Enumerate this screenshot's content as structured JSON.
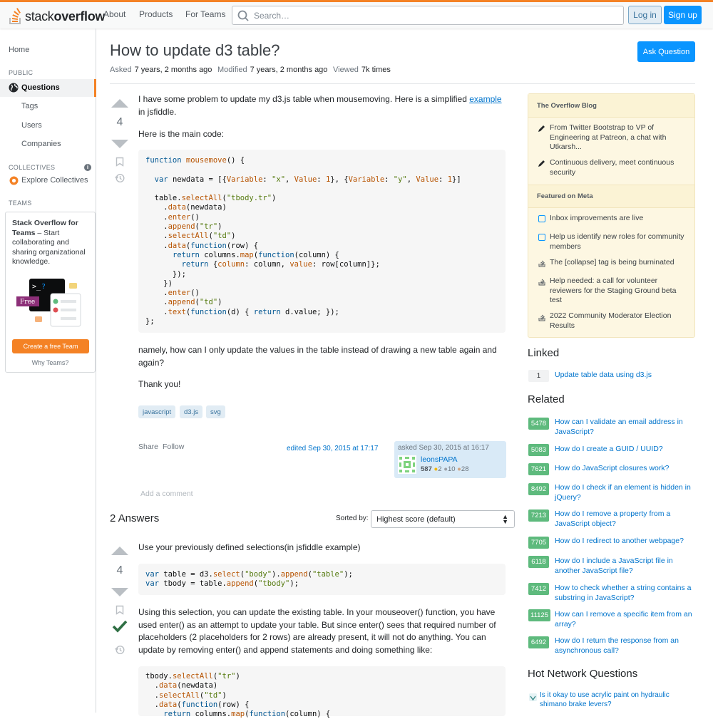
{
  "header": {
    "logo_light": "stack",
    "logo_bold": "overflow",
    "nav": [
      "About",
      "Products",
      "For Teams"
    ],
    "search_placeholder": "Search…",
    "login": "Log in",
    "signup": "Sign up"
  },
  "sidebar": {
    "home": "Home",
    "public_label": "PUBLIC",
    "questions": "Questions",
    "tags": "Tags",
    "users": "Users",
    "companies": "Companies",
    "collectives_label": "COLLECTIVES",
    "explore_collectives": "Explore Collectives",
    "teams_label": "TEAMS",
    "teams_promo_bold": "Stack Overflow for Teams",
    "teams_promo_text": " – Start collaborating and sharing organizational knowledge.",
    "free_badge": "Free",
    "create_team": "Create a free Team",
    "why_teams": "Why Teams?"
  },
  "question": {
    "title": "How to update d3 table?",
    "ask_button": "Ask Question",
    "asked_label": "Asked",
    "asked_value": "7 years, 2 months ago",
    "modified_label": "Modified",
    "modified_value": "7 years, 2 months ago",
    "viewed_label": "Viewed",
    "viewed_value": "7k times",
    "votes": "4",
    "intro_1": "I have some problem to update my d3.js table when mousemoving. Here is a simplified ",
    "intro_link": "example",
    "intro_2": " in jsfiddle.",
    "main_code_label": "Here is the main code:",
    "outro": "namely, how can I only update the values in the table instead of drawing a new table again and again?",
    "thanks": "Thank you!",
    "tags": [
      "javascript",
      "d3.js",
      "svg"
    ],
    "share": "Share",
    "follow": "Follow",
    "edited": "edited Sep 30, 2015 at 17:17",
    "asked_card": "asked Sep 30, 2015 at 16:17",
    "owner_name": "leonsPAPA",
    "owner_rep": "587",
    "owner_gold": "2",
    "owner_silver": "10",
    "owner_bronze": "28",
    "add_comment": "Add a comment"
  },
  "answers": {
    "heading": "2 Answers",
    "sorted_by": "Sorted by:",
    "sort_value": "Highest score (default)",
    "first": {
      "votes": "4",
      "intro": "Use your previously defined selections(in jsfiddle example)",
      "body": "Using this selection, you can update the existing table. In your mouseover() function, you have used enter() as an attempt to update your table. But since enter() sees that required number of placeholders (2 placeholders for 2 rows) are already present, it will not do anything. You can update by removing enter() and append statements and doing something like:"
    }
  },
  "blog": {
    "heading1": "The Overflow Blog",
    "items1": [
      "From Twitter Bootstrap to VP of Engineering at Patreon, a chat with Utkarsh...",
      "Continuous delivery, meet continuous security"
    ],
    "heading2": "Featured on Meta",
    "items2": [
      "Inbox improvements are live",
      "Help us identify new roles for community members",
      "The [collapse] tag is being burninated",
      "Help needed: a call for volunteer reviewers for the Staging Ground beta test",
      "2022 Community Moderator Election Results"
    ]
  },
  "linked": {
    "heading": "Linked",
    "items": [
      {
        "score": "1",
        "title": "Update table data using d3.js"
      }
    ]
  },
  "related": {
    "heading": "Related",
    "items": [
      {
        "score": "5478",
        "title": "How can I validate an email address in JavaScript?"
      },
      {
        "score": "5083",
        "title": "How do I create a GUID / UUID?"
      },
      {
        "score": "7621",
        "title": "How do JavaScript closures work?"
      },
      {
        "score": "8492",
        "title": "How do I check if an element is hidden in jQuery?"
      },
      {
        "score": "7213",
        "title": "How do I remove a property from a JavaScript object?"
      },
      {
        "score": "7705",
        "title": "How do I redirect to another webpage?"
      },
      {
        "score": "6118",
        "title": "How do I include a JavaScript file in another JavaScript file?"
      },
      {
        "score": "7412",
        "title": "How to check whether a string contains a substring in JavaScript?"
      },
      {
        "score": "11125",
        "title": "How can I remove a specific item from an array?"
      },
      {
        "score": "6492",
        "title": "How do I return the response from an asynchronous call?"
      }
    ]
  },
  "hnq": {
    "heading": "Hot Network Questions",
    "items": [
      "Is it okay to use acrylic paint on hydraulic shimano brake levers?"
    ]
  },
  "colors": {
    "accent": "#f48225",
    "primary_button": "#0a95ff",
    "link": "#0074cc",
    "accepted": "#2f6f44",
    "answered_score": "#5eba7d"
  }
}
